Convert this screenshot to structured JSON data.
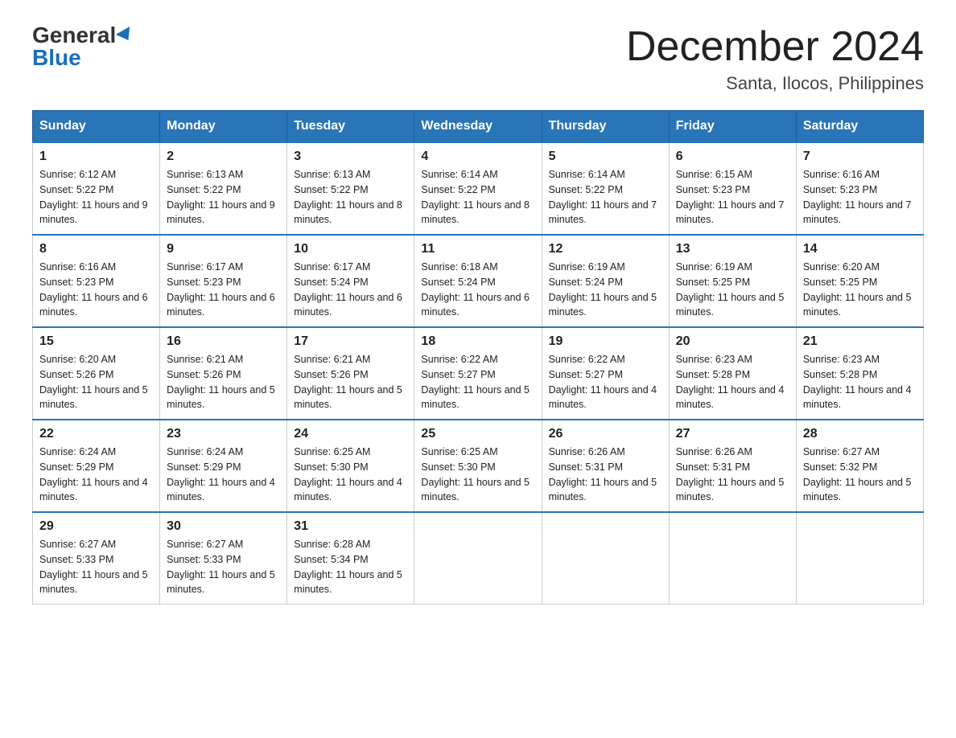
{
  "header": {
    "logo_general": "General",
    "logo_blue": "Blue",
    "month_title": "December 2024",
    "subtitle": "Santa, Ilocos, Philippines"
  },
  "days_of_week": [
    "Sunday",
    "Monday",
    "Tuesday",
    "Wednesday",
    "Thursday",
    "Friday",
    "Saturday"
  ],
  "weeks": [
    [
      {
        "num": "1",
        "sunrise": "6:12 AM",
        "sunset": "5:22 PM",
        "daylight": "11 hours and 9 minutes."
      },
      {
        "num": "2",
        "sunrise": "6:13 AM",
        "sunset": "5:22 PM",
        "daylight": "11 hours and 9 minutes."
      },
      {
        "num": "3",
        "sunrise": "6:13 AM",
        "sunset": "5:22 PM",
        "daylight": "11 hours and 8 minutes."
      },
      {
        "num": "4",
        "sunrise": "6:14 AM",
        "sunset": "5:22 PM",
        "daylight": "11 hours and 8 minutes."
      },
      {
        "num": "5",
        "sunrise": "6:14 AM",
        "sunset": "5:22 PM",
        "daylight": "11 hours and 7 minutes."
      },
      {
        "num": "6",
        "sunrise": "6:15 AM",
        "sunset": "5:23 PM",
        "daylight": "11 hours and 7 minutes."
      },
      {
        "num": "7",
        "sunrise": "6:16 AM",
        "sunset": "5:23 PM",
        "daylight": "11 hours and 7 minutes."
      }
    ],
    [
      {
        "num": "8",
        "sunrise": "6:16 AM",
        "sunset": "5:23 PM",
        "daylight": "11 hours and 6 minutes."
      },
      {
        "num": "9",
        "sunrise": "6:17 AM",
        "sunset": "5:23 PM",
        "daylight": "11 hours and 6 minutes."
      },
      {
        "num": "10",
        "sunrise": "6:17 AM",
        "sunset": "5:24 PM",
        "daylight": "11 hours and 6 minutes."
      },
      {
        "num": "11",
        "sunrise": "6:18 AM",
        "sunset": "5:24 PM",
        "daylight": "11 hours and 6 minutes."
      },
      {
        "num": "12",
        "sunrise": "6:19 AM",
        "sunset": "5:24 PM",
        "daylight": "11 hours and 5 minutes."
      },
      {
        "num": "13",
        "sunrise": "6:19 AM",
        "sunset": "5:25 PM",
        "daylight": "11 hours and 5 minutes."
      },
      {
        "num": "14",
        "sunrise": "6:20 AM",
        "sunset": "5:25 PM",
        "daylight": "11 hours and 5 minutes."
      }
    ],
    [
      {
        "num": "15",
        "sunrise": "6:20 AM",
        "sunset": "5:26 PM",
        "daylight": "11 hours and 5 minutes."
      },
      {
        "num": "16",
        "sunrise": "6:21 AM",
        "sunset": "5:26 PM",
        "daylight": "11 hours and 5 minutes."
      },
      {
        "num": "17",
        "sunrise": "6:21 AM",
        "sunset": "5:26 PM",
        "daylight": "11 hours and 5 minutes."
      },
      {
        "num": "18",
        "sunrise": "6:22 AM",
        "sunset": "5:27 PM",
        "daylight": "11 hours and 5 minutes."
      },
      {
        "num": "19",
        "sunrise": "6:22 AM",
        "sunset": "5:27 PM",
        "daylight": "11 hours and 4 minutes."
      },
      {
        "num": "20",
        "sunrise": "6:23 AM",
        "sunset": "5:28 PM",
        "daylight": "11 hours and 4 minutes."
      },
      {
        "num": "21",
        "sunrise": "6:23 AM",
        "sunset": "5:28 PM",
        "daylight": "11 hours and 4 minutes."
      }
    ],
    [
      {
        "num": "22",
        "sunrise": "6:24 AM",
        "sunset": "5:29 PM",
        "daylight": "11 hours and 4 minutes."
      },
      {
        "num": "23",
        "sunrise": "6:24 AM",
        "sunset": "5:29 PM",
        "daylight": "11 hours and 4 minutes."
      },
      {
        "num": "24",
        "sunrise": "6:25 AM",
        "sunset": "5:30 PM",
        "daylight": "11 hours and 4 minutes."
      },
      {
        "num": "25",
        "sunrise": "6:25 AM",
        "sunset": "5:30 PM",
        "daylight": "11 hours and 5 minutes."
      },
      {
        "num": "26",
        "sunrise": "6:26 AM",
        "sunset": "5:31 PM",
        "daylight": "11 hours and 5 minutes."
      },
      {
        "num": "27",
        "sunrise": "6:26 AM",
        "sunset": "5:31 PM",
        "daylight": "11 hours and 5 minutes."
      },
      {
        "num": "28",
        "sunrise": "6:27 AM",
        "sunset": "5:32 PM",
        "daylight": "11 hours and 5 minutes."
      }
    ],
    [
      {
        "num": "29",
        "sunrise": "6:27 AM",
        "sunset": "5:33 PM",
        "daylight": "11 hours and 5 minutes."
      },
      {
        "num": "30",
        "sunrise": "6:27 AM",
        "sunset": "5:33 PM",
        "daylight": "11 hours and 5 minutes."
      },
      {
        "num": "31",
        "sunrise": "6:28 AM",
        "sunset": "5:34 PM",
        "daylight": "11 hours and 5 minutes."
      },
      null,
      null,
      null,
      null
    ]
  ]
}
